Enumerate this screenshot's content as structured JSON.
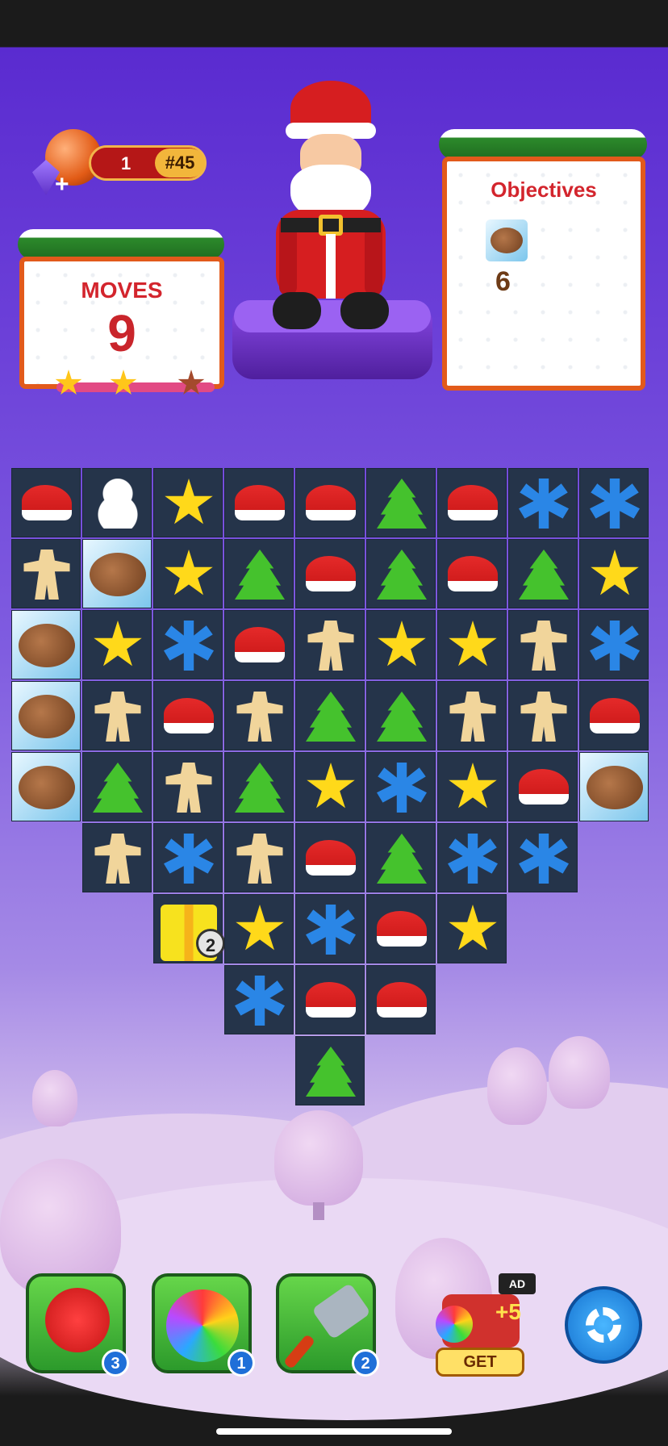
{
  "level": {
    "lives": "1",
    "number": "#45"
  },
  "moves": {
    "title": "MOVES",
    "value": "9",
    "stars_earned": 2,
    "stars_total": 3
  },
  "objectives": {
    "title": "Objectives",
    "items": [
      {
        "icon": "walnut-icon",
        "count": "6"
      }
    ]
  },
  "board": {
    "rows": [
      [
        "hat",
        "snowman",
        "star",
        "hat",
        "hat",
        "tree",
        "hat",
        "flake",
        "flake"
      ],
      [
        "ginger",
        "walnut",
        "star",
        "tree",
        "hat",
        "tree",
        "hat",
        "tree",
        "star"
      ],
      [
        "walnut",
        "star",
        "flake",
        "hat",
        "ginger",
        "star",
        "star",
        "ginger",
        "flake"
      ],
      [
        "walnut",
        "ginger",
        "hat",
        "ginger",
        "tree",
        "tree",
        "ginger",
        "ginger",
        "hat"
      ],
      [
        "walnut",
        "tree",
        "ginger",
        "tree",
        "star",
        "flake",
        "star",
        "hat",
        "walnut"
      ],
      [
        null,
        "ginger",
        "flake",
        "ginger",
        "hat",
        "tree",
        "flake",
        "flake",
        null
      ],
      [
        null,
        null,
        "gift",
        "star",
        "flake",
        "hat",
        "star",
        null,
        null
      ],
      [
        null,
        null,
        null,
        "flake",
        "hat",
        "hat",
        null,
        null,
        null
      ],
      [
        null,
        null,
        null,
        null,
        "tree",
        null,
        null,
        null,
        null
      ]
    ],
    "gift_count": "2"
  },
  "boosters": [
    {
      "name": "lollipop-hammer-icon",
      "count": "3"
    },
    {
      "name": "rainbow-bomb-icon",
      "count": "1"
    },
    {
      "name": "spatula-icon",
      "count": "2"
    }
  ],
  "offer": {
    "bonus": "+5",
    "ad_label": "AD",
    "button": "GET"
  },
  "colors": {
    "moves_text": "#c9252b",
    "panel_border": "#e25a1b",
    "board_cell": "#25344a"
  }
}
